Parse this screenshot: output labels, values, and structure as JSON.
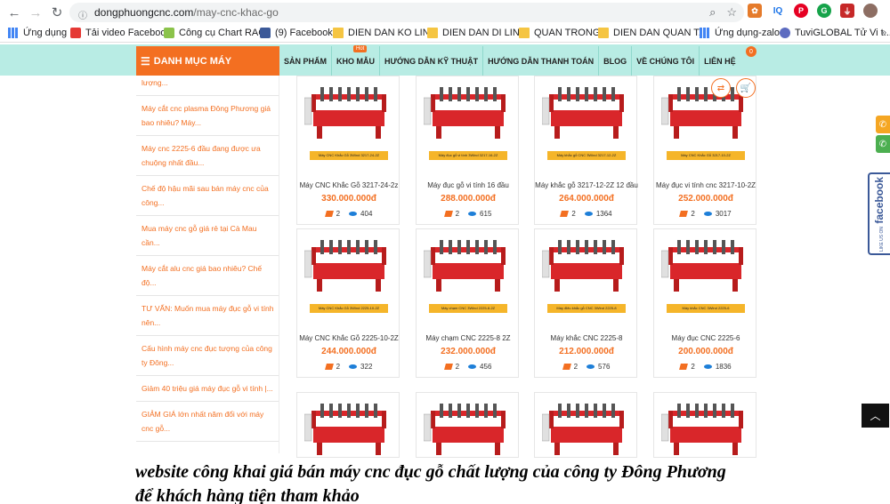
{
  "browser": {
    "url_host": "dongphuongcnc.com",
    "url_path": "/may-cnc-khac-go",
    "bookmarks": [
      {
        "label": "Ứng dụng",
        "icon": "apps-icon"
      },
      {
        "label": "Tải video Facebook",
        "icon": "bookmark-icon"
      },
      {
        "label": "Công cụ Chart RACI",
        "icon": "bookmark-icon"
      },
      {
        "label": "(9) Facebook",
        "icon": "facebook-icon"
      },
      {
        "label": "DIEN DAN KO LINK",
        "icon": "folder-icon"
      },
      {
        "label": "DIEN DAN DI LINK",
        "icon": "folder-icon"
      },
      {
        "label": "QUAN TRONG",
        "icon": "folder-icon"
      },
      {
        "label": "DIEN DAN QUAN T...",
        "icon": "folder-icon"
      },
      {
        "label": "Ứng dụng-zalo",
        "icon": "apps-icon"
      },
      {
        "label": "TuviGLOBAL Tử Vi t...",
        "icon": "bookmark-icon"
      }
    ]
  },
  "site": {
    "danh_muc_label": "DANH MỤC MÁY",
    "menu": [
      "SẢN PHẨM",
      "KHO MẪU",
      "HƯỚNG DẪN KỸ THUẬT",
      "HƯỚNG DẪN THANH TOÁN",
      "BLOG",
      "VỀ CHÚNG TÔI",
      "LIÊN HỆ"
    ],
    "hot_label": "Hot",
    "cart_count": "0"
  },
  "sidebar": {
    "items": [
      "lượng...",
      "Máy cắt cnc plasma Đông Phương giá bao nhiêu? Máy...",
      "Máy cnc 2225-6 đầu đang được ưa chuộng nhất đầu...",
      "Chế độ hậu mãi sau bán máy cnc của công...",
      "Mua máy cnc gỗ giá rẻ tại Cà Mau cần...",
      "Máy cắt alu cnc giá bao nhiêu? Chế độ...",
      "TƯ VẤN: Muốn mua máy đục gỗ vi tính nên...",
      "Cấu hình máy cnc đục tượng của công ty Đông...",
      "Giảm 40 triệu giá máy đục gỗ vi tính |...",
      "GIẢM GIÁ lớn nhất năm đổi với máy cnc gỗ..."
    ]
  },
  "products": [
    {
      "name": "Máy CNC Khắc Gỗ 3217-24-2z",
      "price": "330.000.000đ",
      "likes": "2",
      "views": "404",
      "caption": "Máy CNC Khắc Gỗ 3Wind 3217-24-2Z"
    },
    {
      "name": "Máy đục gỗ vi tính 16 đầu",
      "price": "288.000.000đ",
      "likes": "2",
      "views": "615",
      "caption": "Máy đục gỗ vi tính 3Wind 3217-16-2Z"
    },
    {
      "name": "Máy khắc gỗ 3217-12-2Z 12 đầu",
      "price": "264.000.000đ",
      "likes": "2",
      "views": "1364",
      "caption": "Máy khắc gỗ CNC 3Wind 3217-12-2Z"
    },
    {
      "name": "Máy đục vi tính cnc 3217-10-2Z",
      "price": "252.000.000đ",
      "likes": "2",
      "views": "3017",
      "caption": "Máy CNC Khắc Gỗ 3217-10-2Z"
    },
    {
      "name": "Máy CNC Khắc Gỗ 2225-10-2Z",
      "price": "244.000.000đ",
      "likes": "2",
      "views": "322",
      "caption": "Máy CNC Khắc Gỗ 3Wind 2225-10-2Z"
    },
    {
      "name": "Máy chạm CNC 2225-8 2Z",
      "price": "232.000.000đ",
      "likes": "2",
      "views": "456",
      "caption": "Máy chạm CNC 3Wind 2225-8-2Z"
    },
    {
      "name": "Máy khắc CNC 2225-8",
      "price": "212.000.000đ",
      "likes": "2",
      "views": "576",
      "caption": "Máy điêu khắc gỗ CNC 3Wind 2225-8"
    },
    {
      "name": "Máy đục CNC 2225-6",
      "price": "200.000.000đ",
      "likes": "2",
      "views": "1836",
      "caption": "Máy khắc CNC 3Wind 2225-6"
    }
  ],
  "widgets": {
    "facebook_label": "facebook",
    "facebook_small": "LIKE US ON"
  },
  "caption": {
    "line1": "website công khai giá bán máy cnc đục gỗ chất lượng của công ty Đông Phương",
    "line2": "để khách hàng tiện tham khảo"
  },
  "colors": {
    "accent": "#f36f21",
    "nav_bg": "#b8ece4",
    "machine_red": "#d9262a"
  }
}
